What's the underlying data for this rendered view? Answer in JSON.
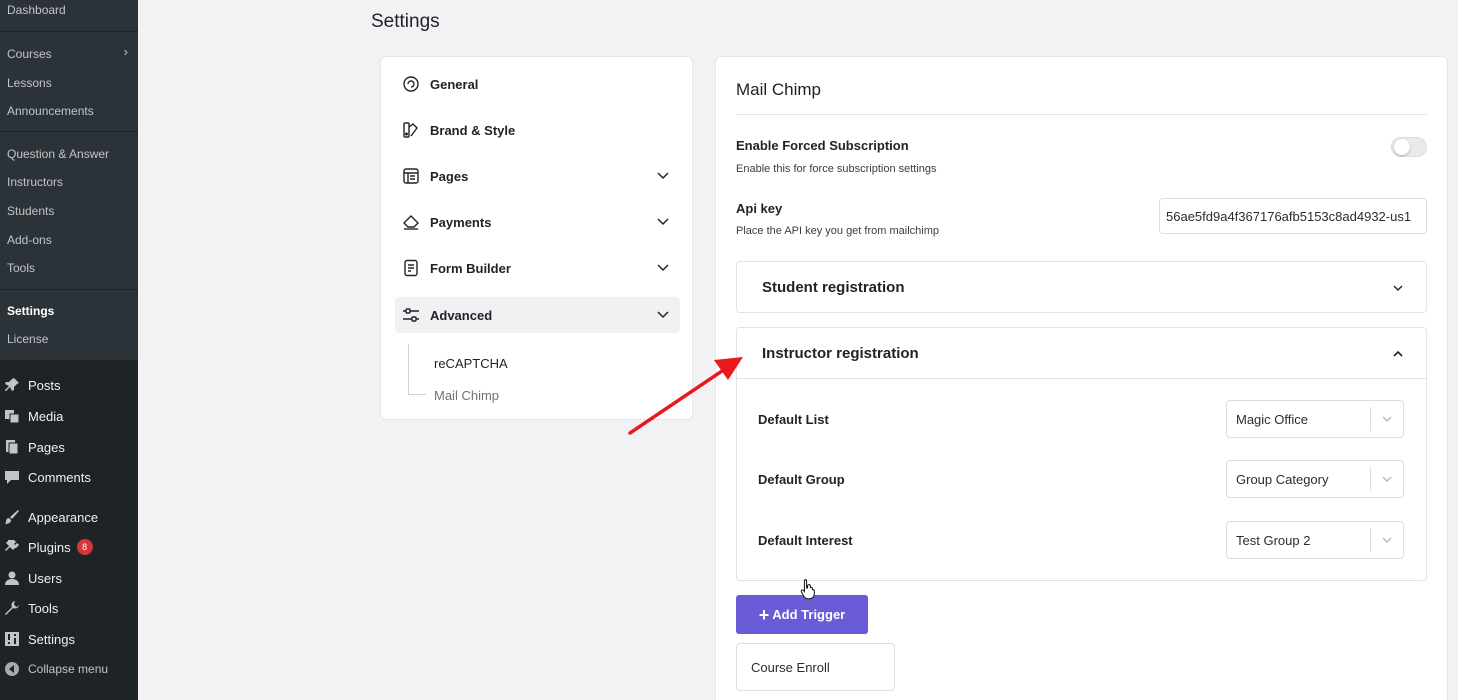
{
  "wp_submenu": {
    "items": [
      {
        "label": "Dashboard"
      },
      {
        "label": "Courses"
      },
      {
        "label": "Lessons"
      },
      {
        "label": "Announcements"
      },
      {
        "label": "Question & Answer"
      },
      {
        "label": "Instructors"
      },
      {
        "label": "Students"
      },
      {
        "label": "Add-ons"
      },
      {
        "label": "Tools"
      },
      {
        "label": "Settings"
      },
      {
        "label": "License"
      }
    ]
  },
  "wp_menu": {
    "items": [
      {
        "label": "Posts",
        "icon": "pin-icon"
      },
      {
        "label": "Media",
        "icon": "media-icon"
      },
      {
        "label": "Pages",
        "icon": "pages-icon"
      },
      {
        "label": "Comments",
        "icon": "comment-icon"
      },
      {
        "label": "Appearance",
        "icon": "brush-icon"
      },
      {
        "label": "Plugins",
        "icon": "plug-icon",
        "badge": "8"
      },
      {
        "label": "Users",
        "icon": "user-icon"
      },
      {
        "label": "Tools",
        "icon": "wrench-icon"
      },
      {
        "label": "Settings",
        "icon": "settings-icon"
      },
      {
        "label": "Collapse menu",
        "icon": "collapse-icon"
      }
    ]
  },
  "page": {
    "title": "Settings"
  },
  "settings_nav": {
    "items": [
      {
        "label": "General"
      },
      {
        "label": "Brand & Style"
      },
      {
        "label": "Pages"
      },
      {
        "label": "Payments"
      },
      {
        "label": "Form Builder"
      },
      {
        "label": "Advanced"
      }
    ],
    "sub_items": [
      {
        "label": "reCAPTCHA"
      },
      {
        "label": "Mail Chimp"
      }
    ]
  },
  "mailchimp": {
    "title": "Mail Chimp",
    "forced_subscription": {
      "label": "Enable Forced Subscription",
      "help": "Enable this for force subscription settings",
      "enabled": false
    },
    "api_key": {
      "label": "Api key",
      "help": "Place the API key you get from mailchimp",
      "value": "56ae5fd9a4f367176afb5153c8ad4932-us1"
    },
    "student_registration": {
      "title": "Student registration"
    },
    "instructor_registration": {
      "title": "Instructor registration",
      "rows": [
        {
          "label": "Default List",
          "value": "Magic Office"
        },
        {
          "label": "Default Group",
          "value": "Group Category"
        },
        {
          "label": "Default Interest",
          "value": "Test Group 2"
        }
      ]
    },
    "add_trigger_label": "Add Trigger",
    "trigger": {
      "label": "Course Enroll"
    }
  },
  "colors": {
    "accent": "#6a5bd6",
    "arrow": "#e8191c",
    "wp_sidebar": "#1d2327"
  }
}
